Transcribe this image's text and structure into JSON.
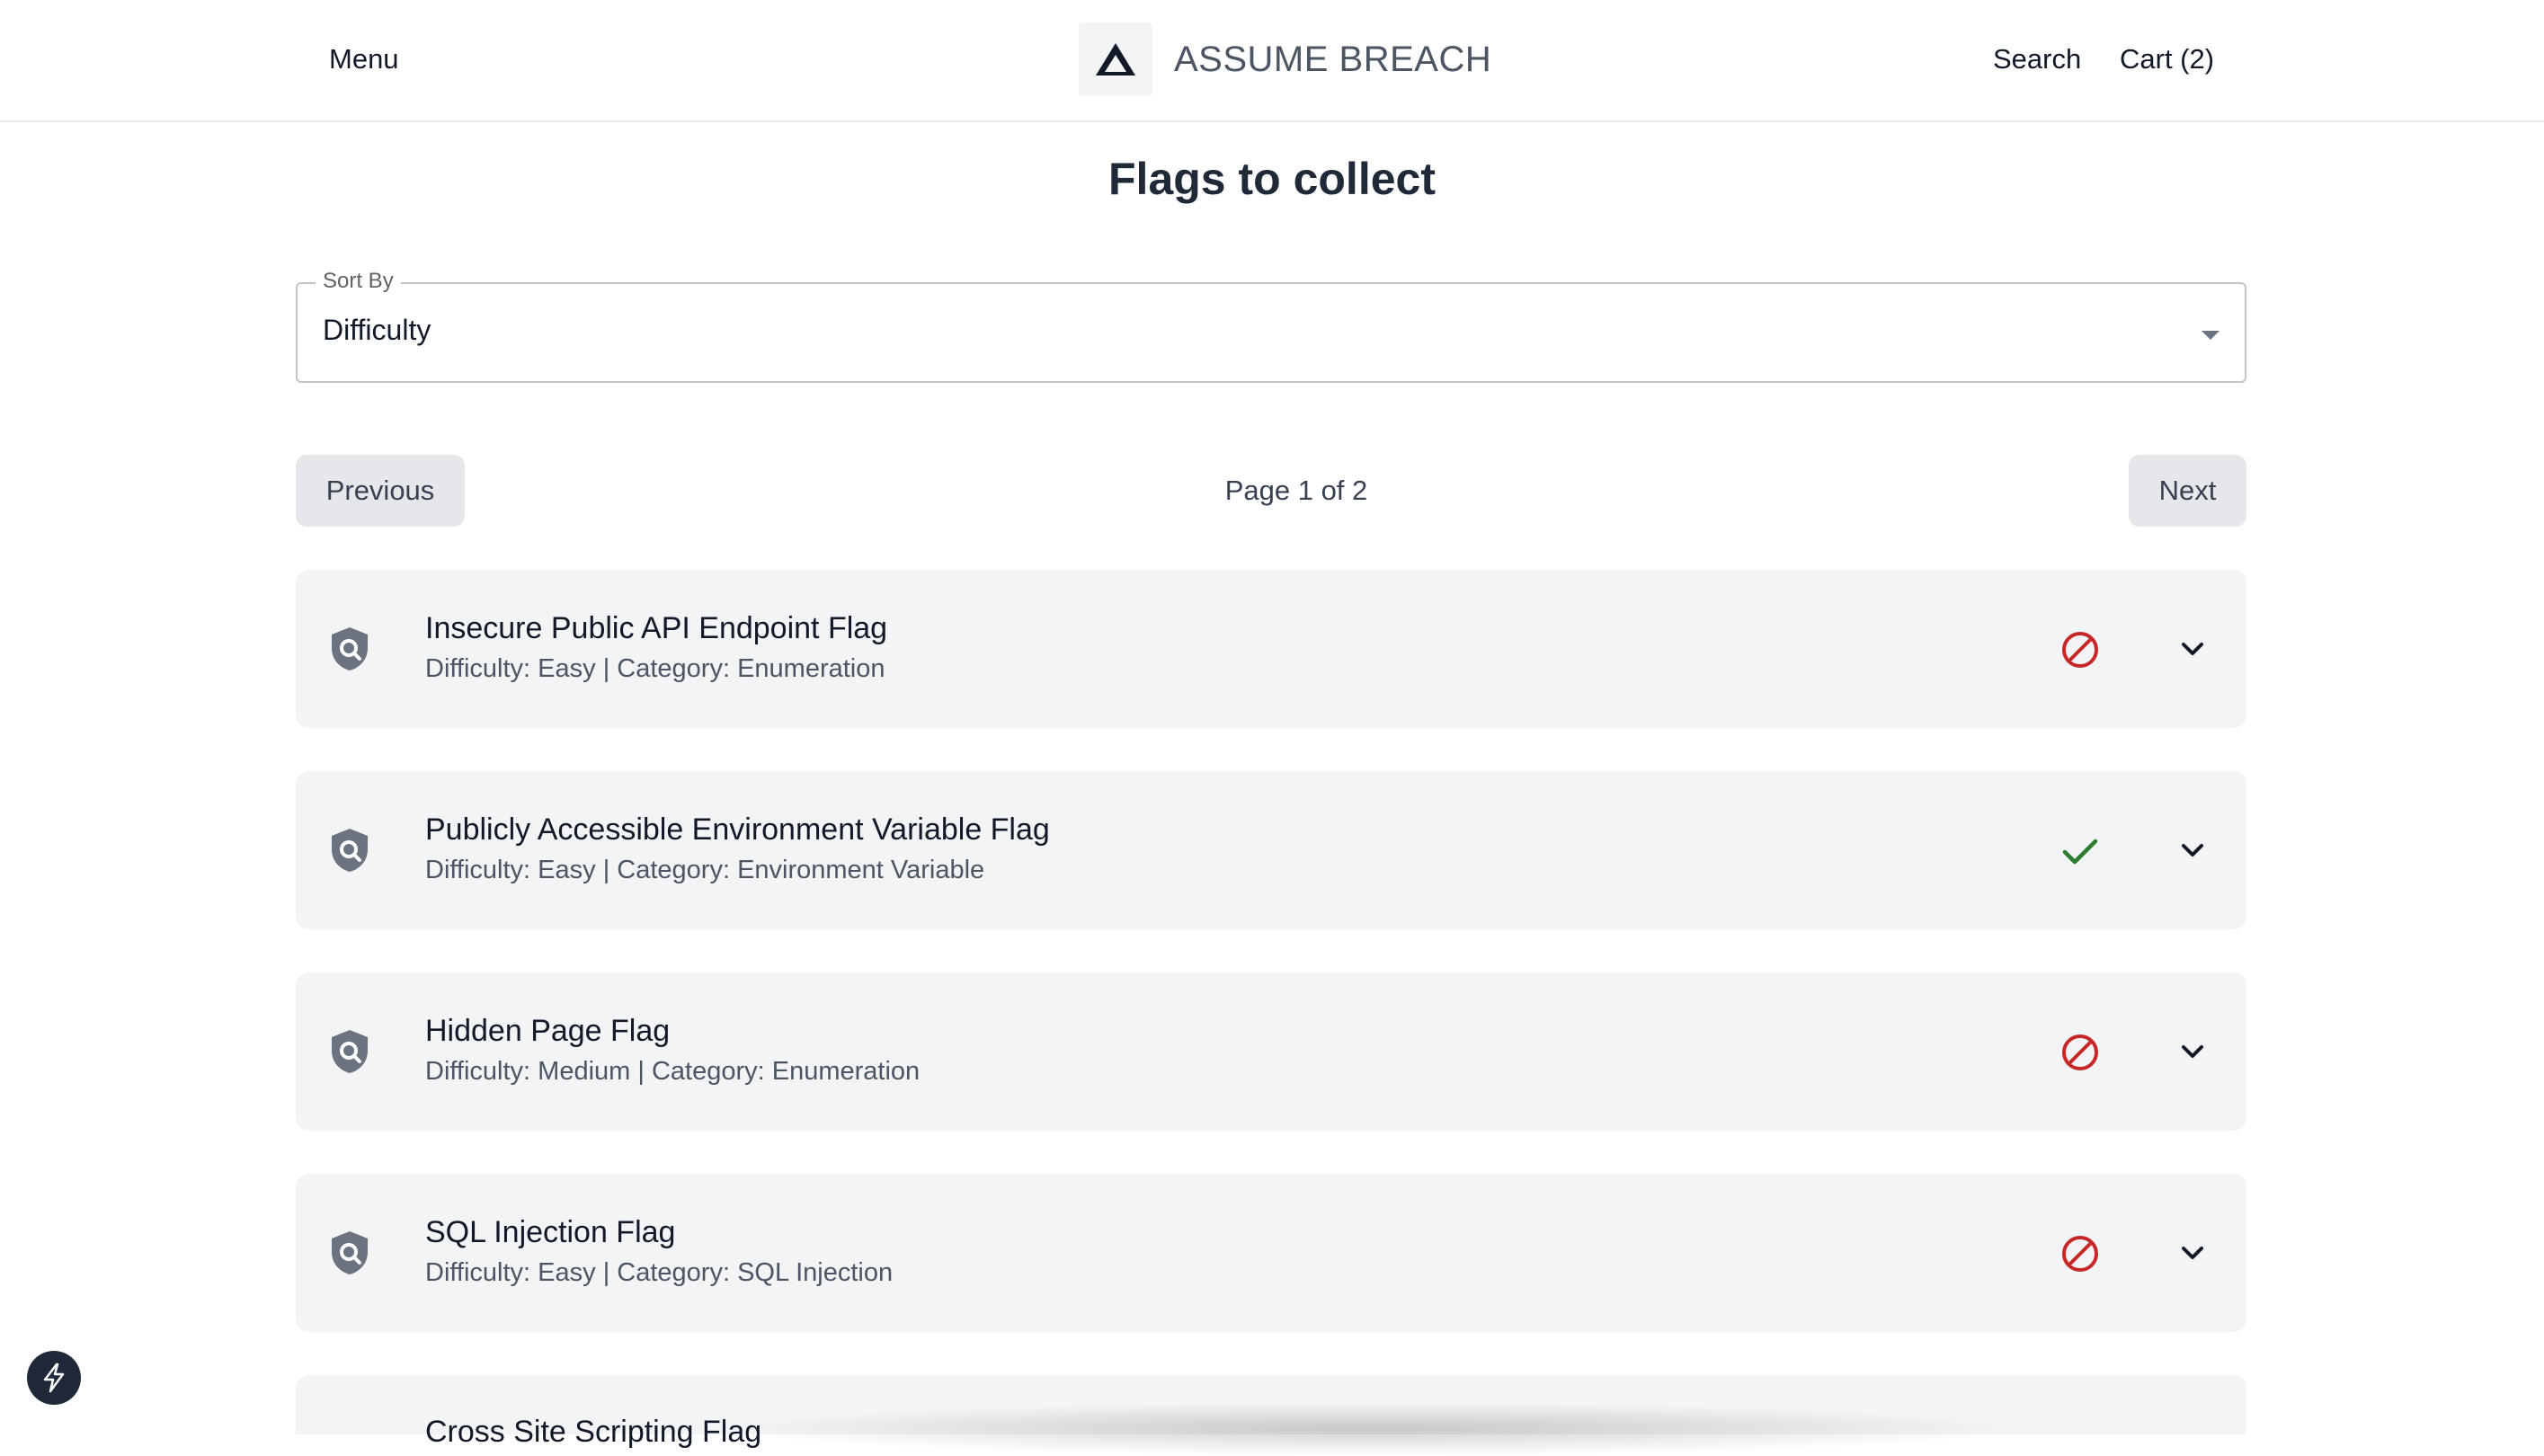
{
  "header": {
    "menu_label": "Menu",
    "brand_name": "ASSUME BREACH",
    "logo_icon": "triangle-logo-icon",
    "search_label": "Search",
    "cart_label": "Cart (2)"
  },
  "page": {
    "title": "Flags to collect"
  },
  "sort": {
    "label": "Sort By",
    "value": "Difficulty"
  },
  "pagination": {
    "previous_label": "Previous",
    "next_label": "Next",
    "page_text": "Page 1 of 2"
  },
  "colors": {
    "blocked": "#c62828",
    "collected": "#2e7d32",
    "card_bg": "#f3f4f6"
  },
  "flags": [
    {
      "title": "Insecure Public API Endpoint Flag",
      "meta": "Difficulty: Easy | Category: Enumeration",
      "status": "not-collected",
      "status_icon": "blocked-icon"
    },
    {
      "title": "Publicly Accessible Environment Variable Flag",
      "meta": "Difficulty: Easy | Category: Environment Variable",
      "status": "collected",
      "status_icon": "check-icon"
    },
    {
      "title": "Hidden Page Flag",
      "meta": "Difficulty: Medium | Category: Enumeration",
      "status": "not-collected",
      "status_icon": "blocked-icon"
    },
    {
      "title": "SQL Injection Flag",
      "meta": "Difficulty: Easy | Category: SQL Injection",
      "status": "not-collected",
      "status_icon": "blocked-icon"
    },
    {
      "title": "Cross Site Scripting Flag",
      "meta": "",
      "status": "",
      "status_icon": ""
    }
  ],
  "floating_button_icon": "lightning-bolt-icon"
}
